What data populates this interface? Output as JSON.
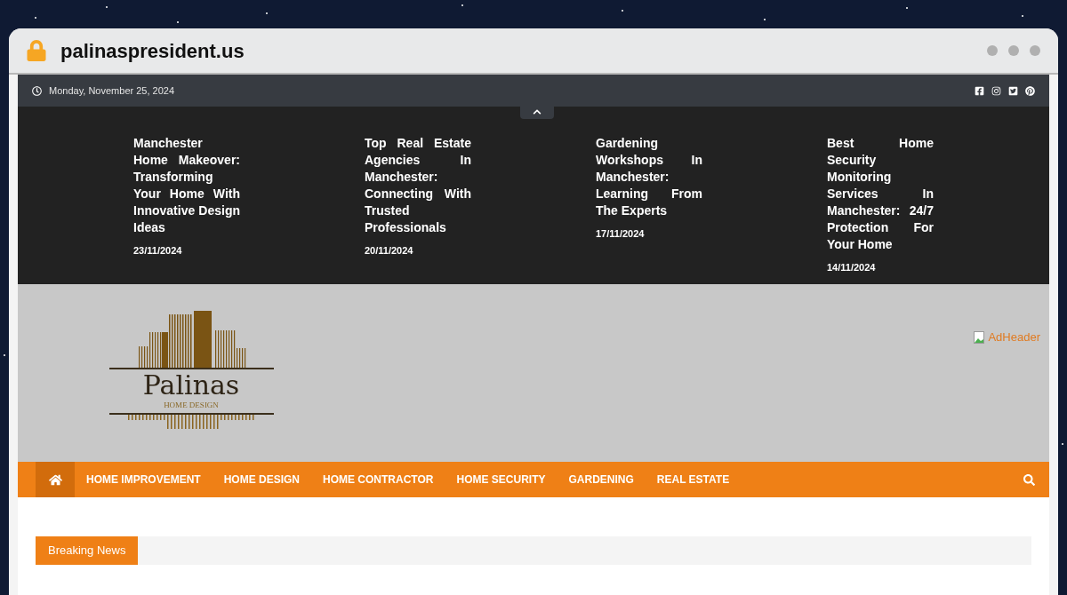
{
  "browser": {
    "address": "palinaspresident.us"
  },
  "topbar": {
    "date": "Monday, November 25, 2024"
  },
  "ticker": [
    {
      "title": "Manchester Home Makeover: Transforming Your Home With Innovative Design Ideas",
      "date": "23/11/2024"
    },
    {
      "title": "Top Real Estate Agencies In Manchester: Connecting With Trusted Professionals",
      "date": "20/11/2024"
    },
    {
      "title": "Gardening Workshops In Manchester: Learning From The Experts",
      "date": "17/11/2024"
    },
    {
      "title": "Best Home Security Monitoring Services In Manchester: 24/7 Protection For Your Home",
      "date": "14/11/2024"
    }
  ],
  "logo": {
    "name": "Palinas",
    "tagline": "HOME DESIGN"
  },
  "ad": {
    "alt": "AdHeader"
  },
  "nav": {
    "home_selected": true,
    "items": [
      {
        "label": "HOME IMPROVEMENT",
        "selected": false
      },
      {
        "label": "HOME DESIGN",
        "selected": false
      },
      {
        "label": "HOME CONTRACTOR",
        "selected": false
      },
      {
        "label": "HOME SECURITY",
        "selected": false
      },
      {
        "label": "GARDENING",
        "selected": false
      },
      {
        "label": "REAL ESTATE",
        "selected": false
      }
    ]
  },
  "breaking": {
    "label": "Breaking News"
  }
}
